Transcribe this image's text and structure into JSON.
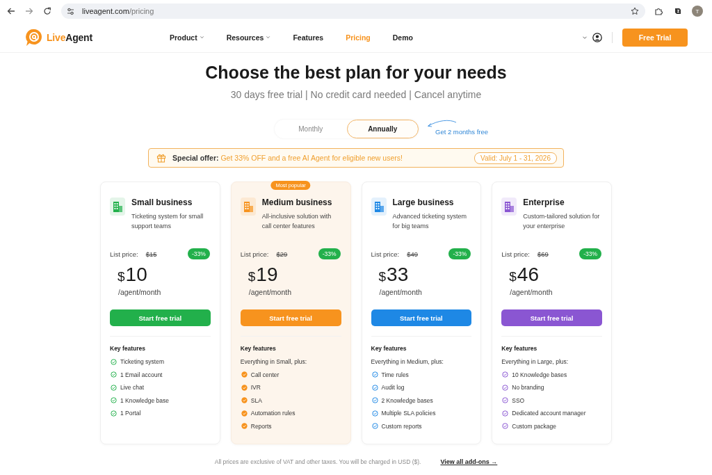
{
  "browser": {
    "address": {
      "host": "liveagent.com",
      "path": "/pricing"
    },
    "profile_initial": "T"
  },
  "header": {
    "logo": {
      "first": "Live",
      "second": "Agent"
    },
    "nav": [
      {
        "label": "Product",
        "has_menu": true,
        "selected": false
      },
      {
        "label": "Resources",
        "has_menu": true,
        "selected": false
      },
      {
        "label": "Features",
        "has_menu": false,
        "selected": false
      },
      {
        "label": "Pricing",
        "has_menu": false,
        "selected": true
      },
      {
        "label": "Demo",
        "has_menu": false,
        "selected": false
      }
    ],
    "cta": "Free Trial"
  },
  "hero": {
    "title": "Choose the best plan for your needs",
    "subtitle": "30 days free trial | No credit card needed | Cancel anytime"
  },
  "billing": {
    "options": [
      {
        "label": "Monthly",
        "selected": false
      },
      {
        "label": "Annually",
        "selected": true
      }
    ],
    "note": "Get 2 months free"
  },
  "offer": {
    "lead": "Special offer:",
    "text": "Get 33% OFF and a free AI Agent for eligible new users!",
    "valid": "Valid: July 1 - 31, 2026"
  },
  "plans": [
    {
      "name": "Small business",
      "description": "Ticketing system for small support teams",
      "color": "#22b04b",
      "highlighted": false,
      "list_price_label": "List price:",
      "list_price": "$15",
      "discount": "-33%",
      "currency": "$",
      "amount": "10",
      "period": "/agent/month",
      "button": "Start free trial",
      "features_heading": "Key features",
      "features": [
        "Ticketing system",
        "1 Email account",
        "Live chat",
        "1 Knowledge base",
        "1 Portal"
      ]
    },
    {
      "name": "Medium business",
      "description": "All-inclusive solution with call center features",
      "color": "#f7931e",
      "highlighted": true,
      "badge": "Most popular",
      "list_price_label": "List price:",
      "list_price": "$29",
      "discount": "-33%",
      "currency": "$",
      "amount": "19",
      "period": "/agent/month",
      "button": "Start free trial",
      "features_heading": "Key features",
      "features_intro": "Everything in Small, plus:",
      "features": [
        "Call center",
        "IVR",
        "SLA",
        "Automation rules",
        "Reports"
      ]
    },
    {
      "name": "Large business",
      "description": "Advanced ticketing system for big teams",
      "color": "#1e88e5",
      "highlighted": false,
      "list_price_label": "List price:",
      "list_price": "$49",
      "discount": "-33%",
      "currency": "$",
      "amount": "33",
      "period": "/agent/month",
      "button": "Start free trial",
      "features_heading": "Key features",
      "features_intro": "Everything in Medium, plus:",
      "features": [
        "Time rules",
        "Audit log",
        "2 Knowledge bases",
        "Multiple SLA policies",
        "Custom reports"
      ]
    },
    {
      "name": "Enterprise",
      "description": "Custom-tailored solution for your enterprise",
      "color": "#8a56d2",
      "highlighted": false,
      "list_price_label": "List price:",
      "list_price": "$69",
      "discount": "-33%",
      "currency": "$",
      "amount": "46",
      "period": "/agent/month",
      "button": "Start free trial",
      "features_heading": "Key features",
      "features_intro": "Everything in Large, plus:",
      "features": [
        "10 Knowledge bases",
        "No branding",
        "SSO",
        "Dedicated account manager",
        "Custom package"
      ]
    }
  ],
  "footer": {
    "note": "All prices are exclusive of VAT and other taxes. You will be charged in USD ($).",
    "link": "View all add-ons →"
  }
}
